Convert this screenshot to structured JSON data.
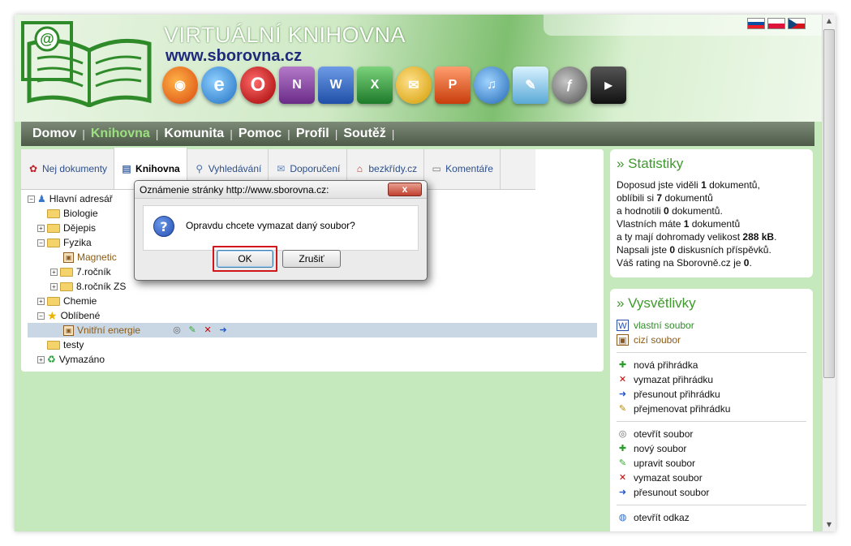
{
  "header": {
    "site_title": "VIRTUÁLNÍ KNIHOVNA",
    "site_url": "www.sborovna.cz",
    "app_icons": [
      "firefox-icon",
      "internet-explorer-icon",
      "opera-icon",
      "onenote-icon",
      "word-icon",
      "excel-icon",
      "outlook-icon",
      "powerpoint-icon",
      "media-player-icon",
      "publisher-icon",
      "flash-icon",
      "avi-icon"
    ],
    "flags": [
      "slovak-flag-icon",
      "polish-flag-icon",
      "czech-flag-icon"
    ]
  },
  "nav": {
    "items": [
      {
        "label": "Domov",
        "active": false
      },
      {
        "label": "Knihovna",
        "active": true
      },
      {
        "label": "Komunita",
        "active": false
      },
      {
        "label": "Pomoc",
        "active": false
      },
      {
        "label": "Profil",
        "active": false
      },
      {
        "label": "Soutěž",
        "active": false
      }
    ],
    "separator": "|"
  },
  "tabs": [
    {
      "label": "Nej dokumenty",
      "icon": "ribbon-icon",
      "active": false
    },
    {
      "label": "Knihovna",
      "icon": "book-icon",
      "active": true
    },
    {
      "label": "Vyhledávání",
      "icon": "search-icon",
      "active": false
    },
    {
      "label": "Doporučení",
      "icon": "envelope-icon",
      "active": false
    },
    {
      "label": "bezkřídy.cz",
      "icon": "home-icon",
      "active": false
    },
    {
      "label": "Komentáře",
      "icon": "comment-icon",
      "active": false
    }
  ],
  "tree": {
    "root": "Hlavní adresář",
    "biologie": "Biologie",
    "dejepis": "Dějepis",
    "fyzika": "Fyzika",
    "magnetic": "Magnetic",
    "rocnik7": "7.ročník",
    "rocnik8": "8.ročník ZS",
    "chemie": "Chemie",
    "oblibene": "Oblíbené",
    "vnitrni": "Vnitřní energie",
    "testy": "testy",
    "vymazano": "Vymazáno"
  },
  "dialog": {
    "title": "Oznámenie stránky http://www.sborovna.cz:",
    "close": "x",
    "message": "Opravdu chcete vymazat daný soubor?",
    "ok": "OK",
    "cancel": "Zrušiť"
  },
  "stats": {
    "title": "» Statistiky",
    "line1_a": "Doposud jste viděli ",
    "line1_b": "1",
    "line1_c": " dokumentů,",
    "line2_a": "oblíbili si ",
    "line2_b": "7",
    "line2_c": " dokumentů",
    "line3_a": "a hodnotili ",
    "line3_b": "0",
    "line3_c": " dokumentů.",
    "line4_a": "Vlastních máte ",
    "line4_b": "1",
    "line4_c": " dokumentů",
    "line5_a": "a ty mají dohromady velikost ",
    "line5_b": "288 kB",
    "line5_c": ".",
    "line6_a": "Napsali jste ",
    "line6_b": "0",
    "line6_c": " diskusních příspěvků.",
    "line7_a": "Váš rating na Sborovně.cz je ",
    "line7_b": "0",
    "line7_c": "."
  },
  "legend": {
    "title": "» Vysvětlivky",
    "own_file": "vlastní soubor",
    "foreign_file": "cizí soubor",
    "new_box": "nová přihrádka",
    "delete_box": "vymazat přihrádku",
    "move_box": "přesunout přihrádku",
    "rename_box": "přejmenovat přihrádku",
    "open_file": "otevřít soubor",
    "new_file": "nový soubor",
    "edit_file": "upravit soubor",
    "delete_file": "vymazat soubor",
    "move_file": "přesunout soubor",
    "open_link": "otevřít odkaz"
  }
}
